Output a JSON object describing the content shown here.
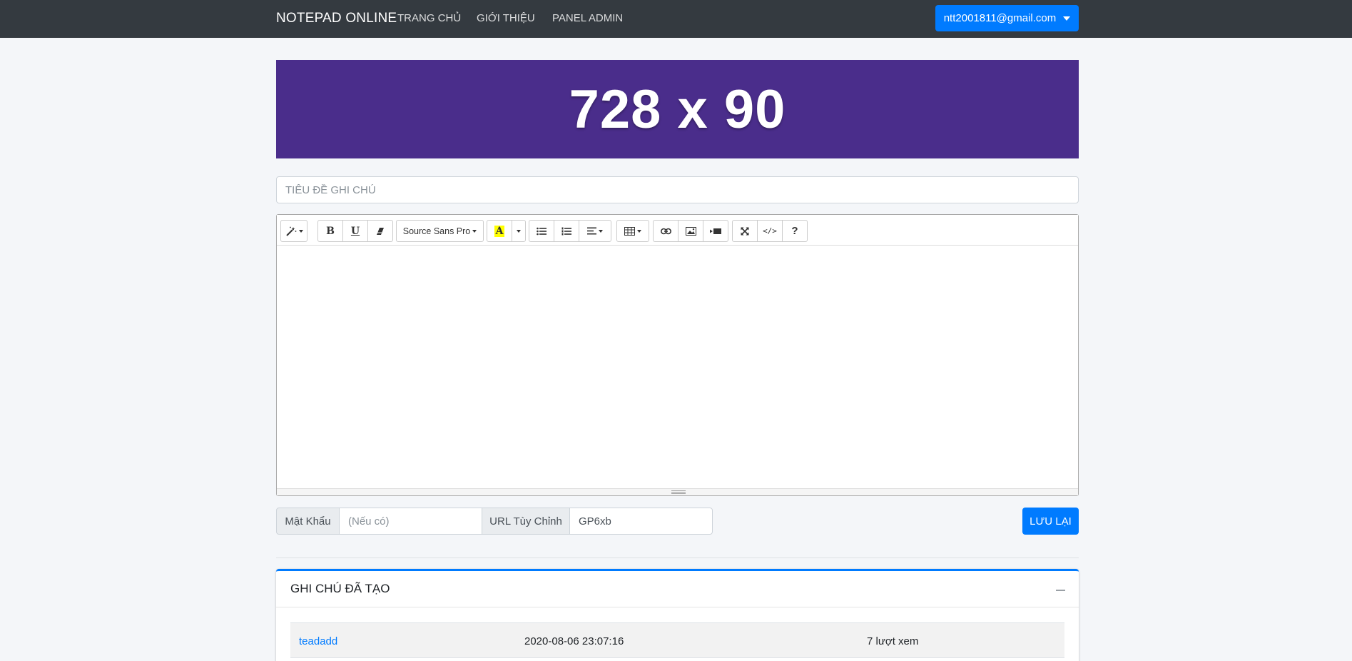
{
  "navbar": {
    "brand": "NOTEPAD ONLINE",
    "links": [
      "TRANG CHỦ",
      "GIỚI THIỆU",
      "PANEL ADMIN"
    ],
    "user_email": "ntt2001811@gmail.com"
  },
  "banner": {
    "text": "728 x 90",
    "color": "#4a2d8b"
  },
  "title_field": {
    "placeholder": "TIÊU ĐỀ GHI CHÚ",
    "value": ""
  },
  "editor": {
    "toolbar": {
      "style_icon": "magic-wand-icon",
      "bold_label": "B",
      "underline_label": "U",
      "clear_icon": "eraser-icon",
      "font_name": "Source Sans Pro",
      "color_label": "A",
      "unordered_list_icon": "unordered-list-icon",
      "ordered_list_icon": "ordered-list-icon",
      "paragraph_icon": "align-left-icon",
      "table_icon": "table-icon",
      "link_icon": "link-icon",
      "picture_icon": "picture-icon",
      "video_icon": "video-icon",
      "fullscreen_icon": "fullscreen-icon",
      "codeview_label": "</>",
      "help_label": "?"
    },
    "content": ""
  },
  "form": {
    "password_label": "Mật Khẩu",
    "password_placeholder": "(Nếu có)",
    "url_label": "URL Tùy Chỉnh",
    "url_value": "GP6xb",
    "save_label": "LƯU LẠI"
  },
  "notes_card": {
    "title": "GHI CHÚ ĐÃ TẠO",
    "rows": [
      {
        "name": "teadadd",
        "date": "2020-08-06 23:07:16",
        "views": "7 lượt xem"
      }
    ]
  },
  "colors": {
    "primary": "#007bff",
    "navbar": "#343a40",
    "background": "#f4f6f9"
  }
}
